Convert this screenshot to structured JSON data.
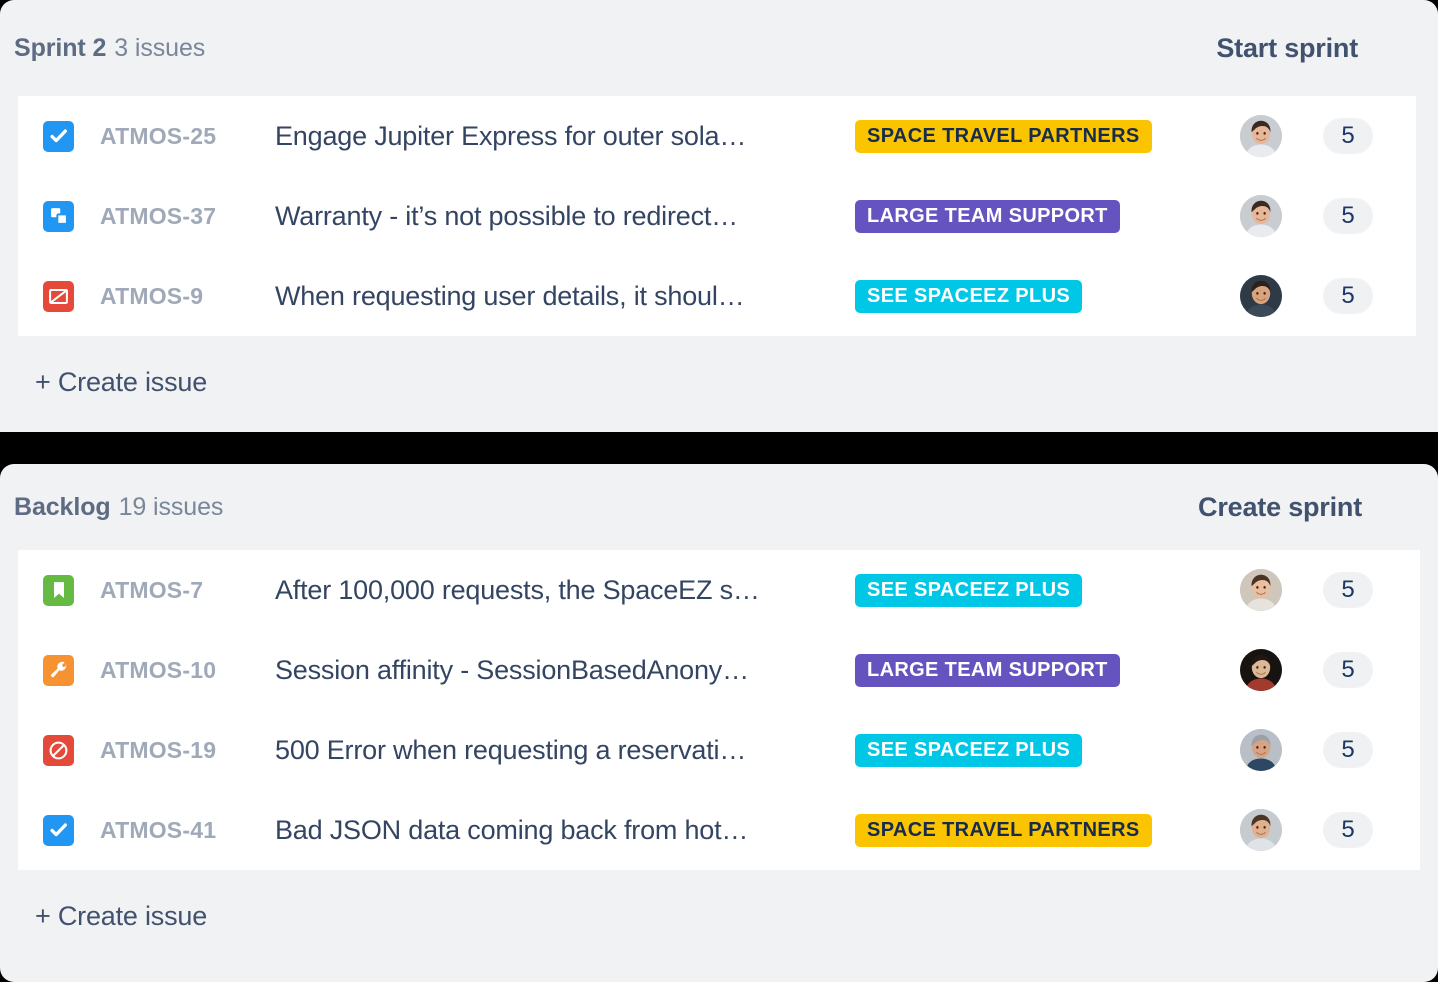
{
  "theme": {
    "panel_bg": "#F1F2F4",
    "list_bg": "#FFFFFF",
    "gap_bg": "#000000",
    "title_color": "#5D6B83",
    "key_color": "#9FA9B8",
    "issue_title_color": "#344563",
    "action_color": "#42526E"
  },
  "sections": [
    {
      "id": "sprint",
      "title": "Sprint 2",
      "count_label": "3 issues",
      "action_label": "Start sprint",
      "action_name": "start-sprint-button",
      "create_label": "+ Create issue",
      "issues": [
        {
          "key": "ATMOS-25",
          "title": "Engage Jupiter Express for outer sola…",
          "type": "task",
          "type_icon": "check-square-icon",
          "type_color": "#2196F3",
          "label": "SPACE TRAVEL PARTNERS",
          "label_bg": "#FAC400",
          "label_color": "#172B4D",
          "points": "5",
          "avatar": "man-smiling-light-bg"
        },
        {
          "key": "ATMOS-37",
          "title": "Warranty - it’s not possible to redirect…",
          "type": "subtask",
          "type_icon": "subtask-icon",
          "type_color": "#2196F3",
          "label": "LARGE TEAM SUPPORT",
          "label_bg": "#6554C0",
          "label_color": "#FFFFFF",
          "points": "5",
          "avatar": "man-smiling-light-bg"
        },
        {
          "key": "ATMOS-9",
          "title": "When requesting user details, it shoul…",
          "type": "bug",
          "type_icon": "error-slash-icon",
          "type_color": "#E5493A",
          "label": "SEE SPACEEZ PLUS",
          "label_bg": "#00C7E6",
          "label_color": "#FFFFFF",
          "points": "5",
          "avatar": "man-beard-dark-bg"
        }
      ]
    },
    {
      "id": "backlog",
      "title": "Backlog",
      "count_label": "19 issues",
      "action_label": "Create sprint",
      "action_name": "create-sprint-button",
      "create_label": "+ Create issue",
      "issues": [
        {
          "key": "ATMOS-7",
          "title": "After 100,000 requests, the SpaceEZ s…",
          "type": "story",
          "type_icon": "bookmark-icon",
          "type_color": "#65BA43",
          "label": "SEE SPACEEZ PLUS",
          "label_bg": "#00C7E6",
          "label_color": "#FFFFFF",
          "points": "5",
          "avatar": "woman-brown-hair"
        },
        {
          "key": "ATMOS-10",
          "title": "Session affinity - SessionBasedAnony…",
          "type": "improvement",
          "type_icon": "wrench-icon",
          "type_color": "#F79232",
          "label": "LARGE TEAM SUPPORT",
          "label_bg": "#6554C0",
          "label_color": "#FFFFFF",
          "points": "5",
          "avatar": "woman-dark-bg-red"
        },
        {
          "key": "ATMOS-19",
          "title": "500 Error when requesting a reservati…",
          "type": "blocked",
          "type_icon": "no-entry-icon",
          "type_color": "#E5493A",
          "label": "SEE SPACEEZ PLUS",
          "label_bg": "#00C7E6",
          "label_color": "#FFFFFF",
          "points": "5",
          "avatar": "man-bald-smiling"
        },
        {
          "key": "ATMOS-41",
          "title": "Bad JSON data coming back from hot…",
          "type": "task",
          "type_icon": "check-square-icon",
          "type_color": "#2196F3",
          "label": "SPACE TRAVEL PARTNERS",
          "label_bg": "#FAC400",
          "label_color": "#172B4D",
          "points": "5",
          "avatar": "man-smiling-gray-bg"
        }
      ]
    }
  ]
}
